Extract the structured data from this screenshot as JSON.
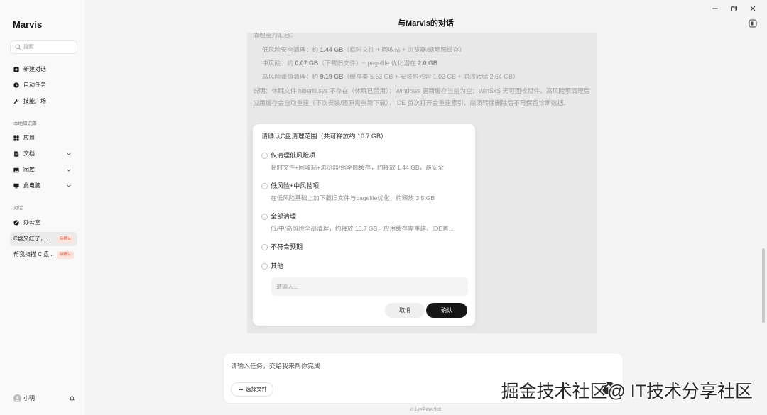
{
  "window": {
    "icons": [
      "minimize-icon",
      "restore-icon",
      "close-icon",
      "panel-toggle-icon"
    ]
  },
  "sidebar": {
    "logo": "Marvis",
    "search": {
      "placeholder": "搜索",
      "icon": "search-icon"
    },
    "nav": [
      {
        "label": "新建对话",
        "icon": "new-chat-icon"
      },
      {
        "label": "自动任务",
        "icon": "clock-icon"
      },
      {
        "label": "技能广场",
        "icon": "wrench-icon"
      }
    ],
    "knowledge_section": "本地知识库",
    "knowledge": [
      {
        "label": "应用",
        "icon": "grid-icon"
      },
      {
        "label": "文档",
        "icon": "document-icon",
        "chevron": "chevron-down-icon"
      },
      {
        "label": "图库",
        "icon": "image-icon",
        "chevron": "chevron-down-icon"
      },
      {
        "label": "此电脑",
        "icon": "monitor-icon",
        "chevron": "chevron-down-icon"
      }
    ],
    "conversation_section": "对话",
    "conversations": [
      {
        "label": "办公室",
        "icon": "project-icon"
      },
      {
        "label": "C盘又红了，...",
        "badge": "待确认",
        "active": true
      },
      {
        "label": "帮我扫描 C 盘...",
        "badge": "待确认"
      }
    ],
    "user": {
      "name": "小明",
      "avatar": "avatar",
      "bell_icon": "bell-icon"
    }
  },
  "header": {
    "title": "与Marvis的对话"
  },
  "message": {
    "heading": "清理能力汇总：",
    "items": [
      {
        "pre": "低风险安全清理：约 ",
        "value": "1.44 GB",
        "post": "（临时文件 + 回收站 + 浏览器/缩略图缓存）"
      },
      {
        "pre": "中风险：约 ",
        "value": "0.07 GB",
        "post": "（下载旧文件）+ pagefile 优化潜在 ",
        "value2": "2.0 GB"
      },
      {
        "pre": "高风险谨慎清理：约 ",
        "value": "9.19 GB",
        "post": "（缓存类 5.53 GB + 安装包残留 1.02 GB + 崩溃转储 2.64 GB）"
      }
    ],
    "note": "说明：休眠文件 hiberfil.sys 不存在（休眠已禁用）；Windows 更新缓存当前为空；WinSxS 无可回收组件。高风险项清理后应用缓存会自动重建（下次安装/还原需重新下载），IDE 首次打开会重建索引，崩溃转储删除后不再保留诊断数据。"
  },
  "dialog": {
    "title": "请确认C盘清理范围（共可释放约 10.7 GB）",
    "options": [
      {
        "label": "仅清理低风险项",
        "description": "临时文件+回收站+浏览器/缩略图缓存，约释放 1.44 GB，最安全"
      },
      {
        "label": "低风险+中风险项",
        "description": "在低风险基础上加下载旧文件与pagefile优化，约释放 3.5 GB"
      },
      {
        "label": "全部清理",
        "description": "低/中/高风险全部清理，约释放 10.7 GB，应用缓存需重建、IDE首..."
      },
      {
        "label": "不符合预期"
      },
      {
        "label": "其他"
      }
    ],
    "other_placeholder": "请输入...",
    "cancel_label": "取消",
    "confirm_label": "确认"
  },
  "composer": {
    "placeholder": "请输入任务，交给我来帮你完成",
    "attach_label": "选择文件",
    "attach_icon": "plus-icon",
    "send_icon": "send-icon"
  },
  "footer_note": "以上内容由AI生成",
  "watermark": "掘金技术社区@ IT技术分享社区",
  "colors": {
    "confirm_button": "#161616",
    "badge_background": "#fbe3de",
    "badge_text": "#d4543b",
    "overlay_panel": "#e8e8e8"
  }
}
